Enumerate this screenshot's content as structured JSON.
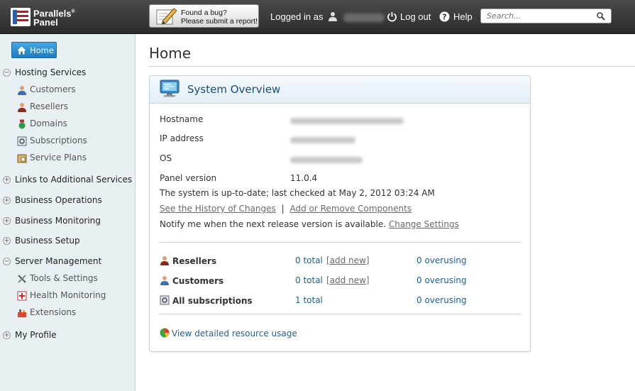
{
  "brand": {
    "line1": "Parallels",
    "mark": "®",
    "line2": "Panel"
  },
  "bug_report": {
    "line1": "Found a bug?",
    "line2": "Please submit a report!"
  },
  "user": {
    "logged_in_label": "Logged in as"
  },
  "nav": {
    "logout": "Log out",
    "help": "Help"
  },
  "search": {
    "placeholder": "Search..."
  },
  "sidebar": {
    "home": "Home",
    "sections": [
      {
        "label": "Hosting Services",
        "expanded": true,
        "items": [
          "Customers",
          "Resellers",
          "Domains",
          "Subscriptions",
          "Service Plans"
        ]
      },
      {
        "label": "Links to Additional Services",
        "expanded": false
      },
      {
        "label": "Business Operations",
        "expanded": false
      },
      {
        "label": "Business Monitoring",
        "expanded": false
      },
      {
        "label": "Business Setup",
        "expanded": false
      },
      {
        "label": "Server Management",
        "expanded": true,
        "items": [
          "Tools & Settings",
          "Health Monitoring",
          "Extensions"
        ]
      },
      {
        "label": "My Profile",
        "expanded": false
      }
    ]
  },
  "page": {
    "title": "Home"
  },
  "overview": {
    "title": "System Overview",
    "hostname_label": "Hostname",
    "ip_label": "IP address",
    "os_label": "OS",
    "version_label": "Panel version",
    "version_value": "11.0.4",
    "status_text": "The system is up-to-date; last checked at May 2, 2012 03:24 AM",
    "history_link": "See the History of Changes",
    "separator": "|",
    "components_link": "Add or Remove Components",
    "notify_text": "Notify me when the next release version is available.",
    "settings_link": "Change Settings",
    "stats": [
      {
        "label": "Resellers",
        "total": "0 total",
        "add": "[add new]",
        "over": "0 overusing"
      },
      {
        "label": "Customers",
        "total": "0 total",
        "add": "[add new]",
        "over": "0 overusing"
      },
      {
        "label": "All subscriptions",
        "total": "1 total",
        "over": "0 overusing"
      }
    ],
    "usage_link": "View detailed resource usage"
  },
  "colors": {
    "accent": "#1c7ec2",
    "link": "#1f5f99",
    "topbar": "#3a3a3a",
    "sidebar": "#e9f0f4"
  }
}
